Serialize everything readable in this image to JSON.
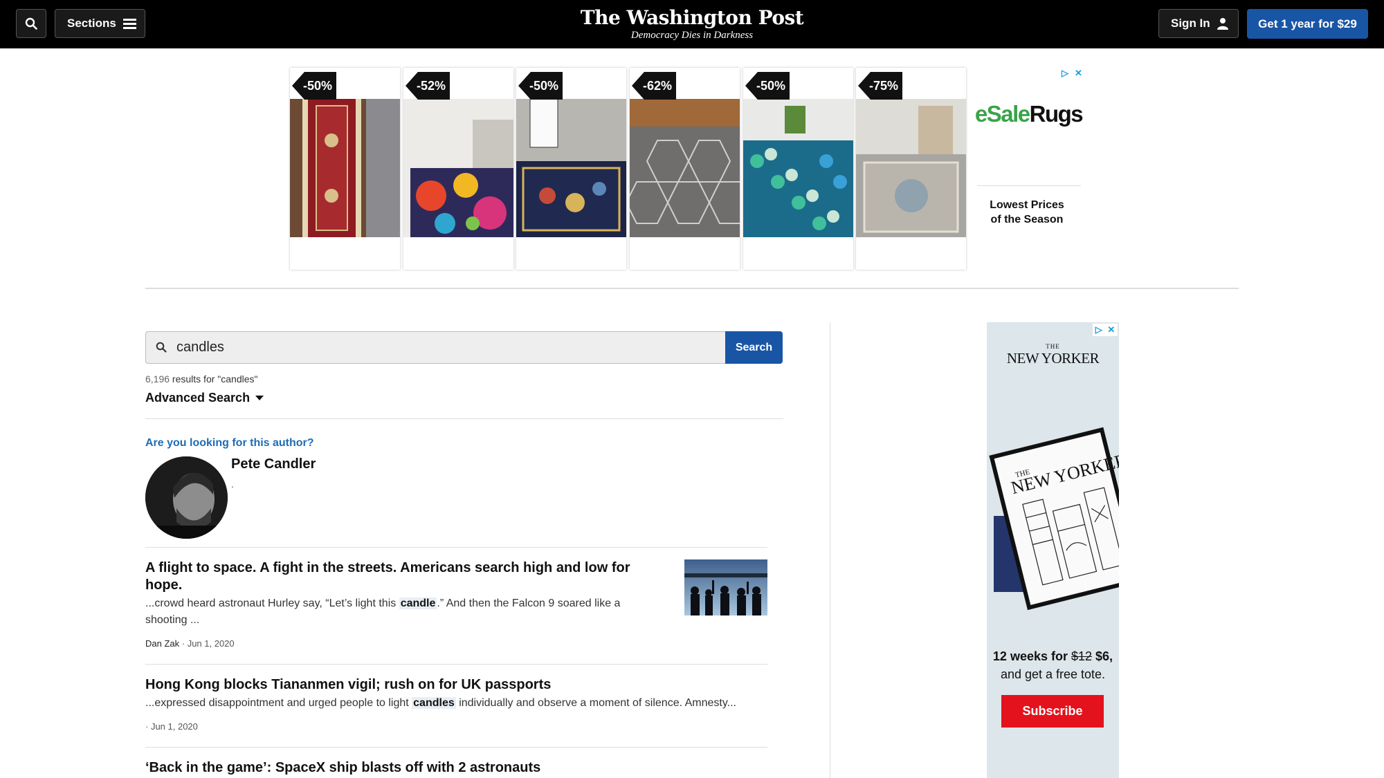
{
  "header": {
    "sections_label": "Sections",
    "logo_name": "The Washington Post",
    "logo_tagline": "Democracy Dies in Darkness",
    "signin_label": "Sign In",
    "subscribe_label": "Get 1 year for $29",
    "colors": {
      "bar": "#000000",
      "subscribe_bg": "#1955a5"
    }
  },
  "top_ad": {
    "discounts": [
      "-50%",
      "-52%",
      "-50%",
      "-62%",
      "-50%",
      "-75%"
    ],
    "brand_prefix": "eSale",
    "brand_suffix": "Rugs",
    "copy": "Lowest Prices of the Season",
    "adchoices_play": "▷",
    "adchoices_close": "✕"
  },
  "search": {
    "query": "candles",
    "button_label": "Search",
    "result_count": "6,196",
    "result_text": " results for \"candles\"",
    "advanced_label": "Advanced Search"
  },
  "author": {
    "question": "Are you looking for this author?",
    "name": "Pete Candler",
    "bio": "."
  },
  "results": [
    {
      "title": "A flight to space. A fight in the streets. Americans search high and low for hope.",
      "snippet_pre": "...crowd heard astronaut Hurley say, “Let’s light this ",
      "snippet_hl": "candle",
      "snippet_post": ".” And then the Falcon 9 soared like a shooting ...",
      "byline": "Dan Zak",
      "date": " · Jun 1, 2020"
    },
    {
      "title": "Hong Kong blocks Tiananmen vigil; rush on for UK passports",
      "snippet_pre": "...expressed disappointment and urged people to light ",
      "snippet_hl": "candles",
      "snippet_post": " individually and observe a moment of silence. Amnesty...",
      "byline": "",
      "date": "· Jun 1, 2020"
    },
    {
      "title": "‘Back in the game’: SpaceX ship blasts off with 2 astronauts"
    }
  ],
  "side_ad": {
    "logo_the": "THE",
    "logo_name": "NEW YORKER",
    "cover_the": "THE",
    "cover_name": "NEW YORKER",
    "offer_line1_pre": "12 weeks for ",
    "offer_strike": "$12",
    "offer_price": " $6,",
    "offer_line2": "and get a free tote.",
    "button_label": "Subscribe",
    "colors": {
      "bg": "#dde6ea",
      "button": "#e3121c"
    }
  }
}
